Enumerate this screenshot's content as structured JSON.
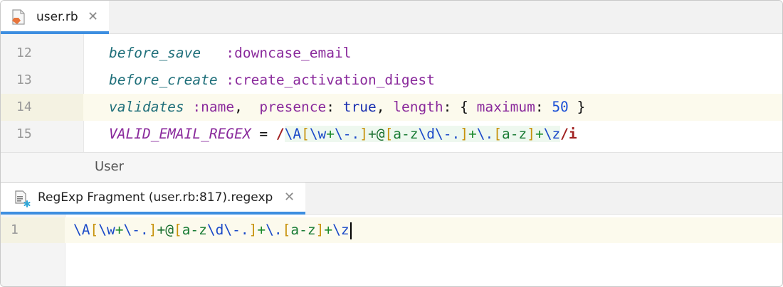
{
  "editor_tab": {
    "filename": "user.rb",
    "close": "✕"
  },
  "lines": [
    {
      "num": "12",
      "t1": "before_save",
      "t2": "   ",
      "t3": ":downcase_email"
    },
    {
      "num": "13",
      "t1": "before_create",
      "t2": " ",
      "t3": ":create_activation_digest"
    },
    {
      "num": "14",
      "t1": "validates",
      "t2": " ",
      "t3": ":name",
      "t4": ",  ",
      "t5": "presence",
      "t6": ": ",
      "t7": "true",
      "t8": ", ",
      "t9": "length",
      "t10": ": { ",
      "t11": "maximum",
      "t12": ": ",
      "t13": "50",
      "t14": " }"
    },
    {
      "num": "15",
      "t1": "VALID_EMAIL_REGEX",
      "t2": " = ",
      "delim_open": "/",
      "delim_close": "/i"
    }
  ],
  "regex_tokens": {
    "a": "\\A",
    "b": "[",
    "c": "\\w",
    "d": "+",
    "e": "\\-.",
    "f": "]",
    "g": "+@",
    "h": "[",
    "i": "a-z",
    "j": "\\d",
    "k": "\\-.",
    "l": "]",
    "m": "+",
    "n": "\\.",
    "o": "[",
    "p": "a-z",
    "q": "]",
    "r": "+",
    "s": "\\z"
  },
  "breadcrumb": "User",
  "fragment_tab": {
    "title": "RegExp Fragment (user.rb:817).regexp",
    "close": "✕"
  },
  "fragment": {
    "line_number": "1"
  },
  "icons": {
    "ruby_file": "ruby-file-icon",
    "regexp_fragment": "regexp-fragment-icon"
  },
  "colors": {
    "accent": "#3d8ee0",
    "current_line": "#fcfaed",
    "keyword": "#1f6f7a",
    "symbol": "#8a2a9c"
  }
}
